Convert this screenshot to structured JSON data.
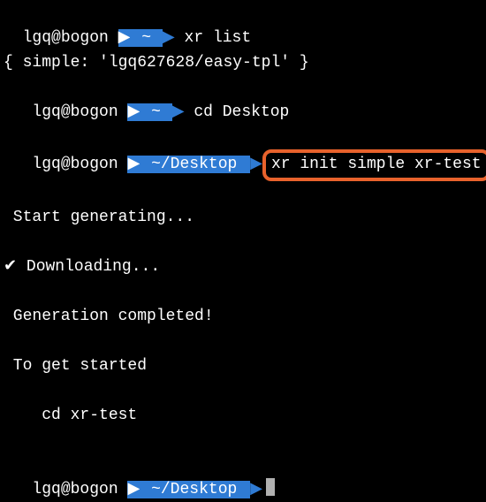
{
  "prompt1": {
    "userhost": "lgq@bogon ",
    "path": " ~ ",
    "cmd": " xr list"
  },
  "output1": "{ simple: 'lgq627628/easy-tpl' }",
  "prompt2": {
    "userhost": " lgq@bogon ",
    "path": " ~ ",
    "cmd": " cd Desktop"
  },
  "prompt3": {
    "userhost": " lgq@bogon ",
    "path": " ~/Desktop ",
    "cmd": "xr init simple xr-test"
  },
  "output_generating": " Start generating...",
  "output_downloading": " Downloading...",
  "check_symbol": "✔",
  "output_completed": " Generation completed!",
  "output_getstarted": " To get started",
  "output_cd": "    cd xr-test",
  "prompt4": {
    "userhost": " lgq@bogon ",
    "path": " ~/Desktop "
  },
  "arrow_right": "▶",
  "arrow_end": "▶"
}
